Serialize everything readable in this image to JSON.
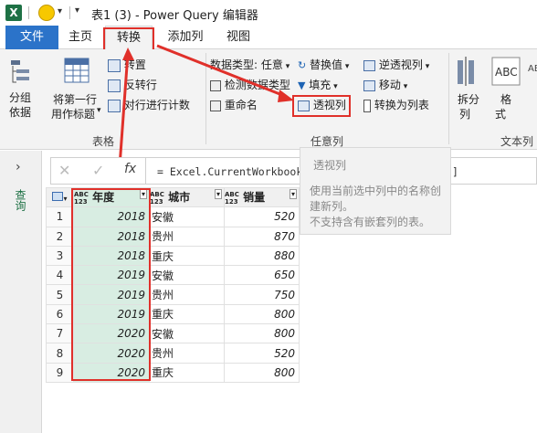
{
  "window": {
    "app_icon": "X",
    "title": "表1 (3) - Power Query 编辑器"
  },
  "tabs": [
    "文件",
    "主页",
    "转换",
    "添加列",
    "视图"
  ],
  "ribbon": {
    "table_group": {
      "group_by": [
        "分组",
        "依据"
      ],
      "first_row_header": [
        "将第一行",
        "用作标题"
      ],
      "transpose": "转置",
      "reverse_rows": "反转行",
      "count_rows": "对行进行计数",
      "label": "表格"
    },
    "any_column_group": {
      "data_type": "数据类型: 任意",
      "detect_type": "检测数据类型",
      "rename": "重命名",
      "replace_values": "替换值",
      "fill": "填充",
      "pivot": "透视列",
      "unpivot": "逆透视列",
      "move": "移动",
      "to_list": "转换为列表",
      "label": "任意列"
    },
    "text_group": {
      "split": [
        "拆分",
        "列"
      ],
      "format": [
        "格",
        "式"
      ],
      "label": "文本列"
    }
  },
  "formula": {
    "text": "= Excel.CurrentWorkbook(){[Name=\"表1\"]}[Content]"
  },
  "tooltip": {
    "title": "透视列",
    "line1": "使用当前选中列中的名称创",
    "line2": "建新列。",
    "line3": "不支持含有嵌套列的表。"
  },
  "left_pane": {
    "label": "查询"
  },
  "columns": [
    {
      "type": "ABC\n123",
      "name": "年度"
    },
    {
      "type": "ABC\n123",
      "name": "城市"
    },
    {
      "type": "ABC\n123",
      "name": "销量"
    }
  ],
  "rows": [
    {
      "n": "1",
      "year": "2018",
      "city": "安徽",
      "sales": "520"
    },
    {
      "n": "2",
      "year": "2018",
      "city": "贵州",
      "sales": "870"
    },
    {
      "n": "3",
      "year": "2018",
      "city": "重庆",
      "sales": "880"
    },
    {
      "n": "4",
      "year": "2019",
      "city": "安徽",
      "sales": "650"
    },
    {
      "n": "5",
      "year": "2019",
      "city": "贵州",
      "sales": "750"
    },
    {
      "n": "6",
      "year": "2019",
      "city": "重庆",
      "sales": "800"
    },
    {
      "n": "7",
      "year": "2020",
      "city": "安徽",
      "sales": "800"
    },
    {
      "n": "8",
      "year": "2020",
      "city": "贵州",
      "sales": "520"
    },
    {
      "n": "9",
      "year": "2020",
      "city": "重庆",
      "sales": "800"
    }
  ],
  "colors": {
    "file_tab": "#2b73c9",
    "excel_green": "#1e7145",
    "highlight_red": "#e0302a",
    "selected_col": "#d8ede2"
  }
}
